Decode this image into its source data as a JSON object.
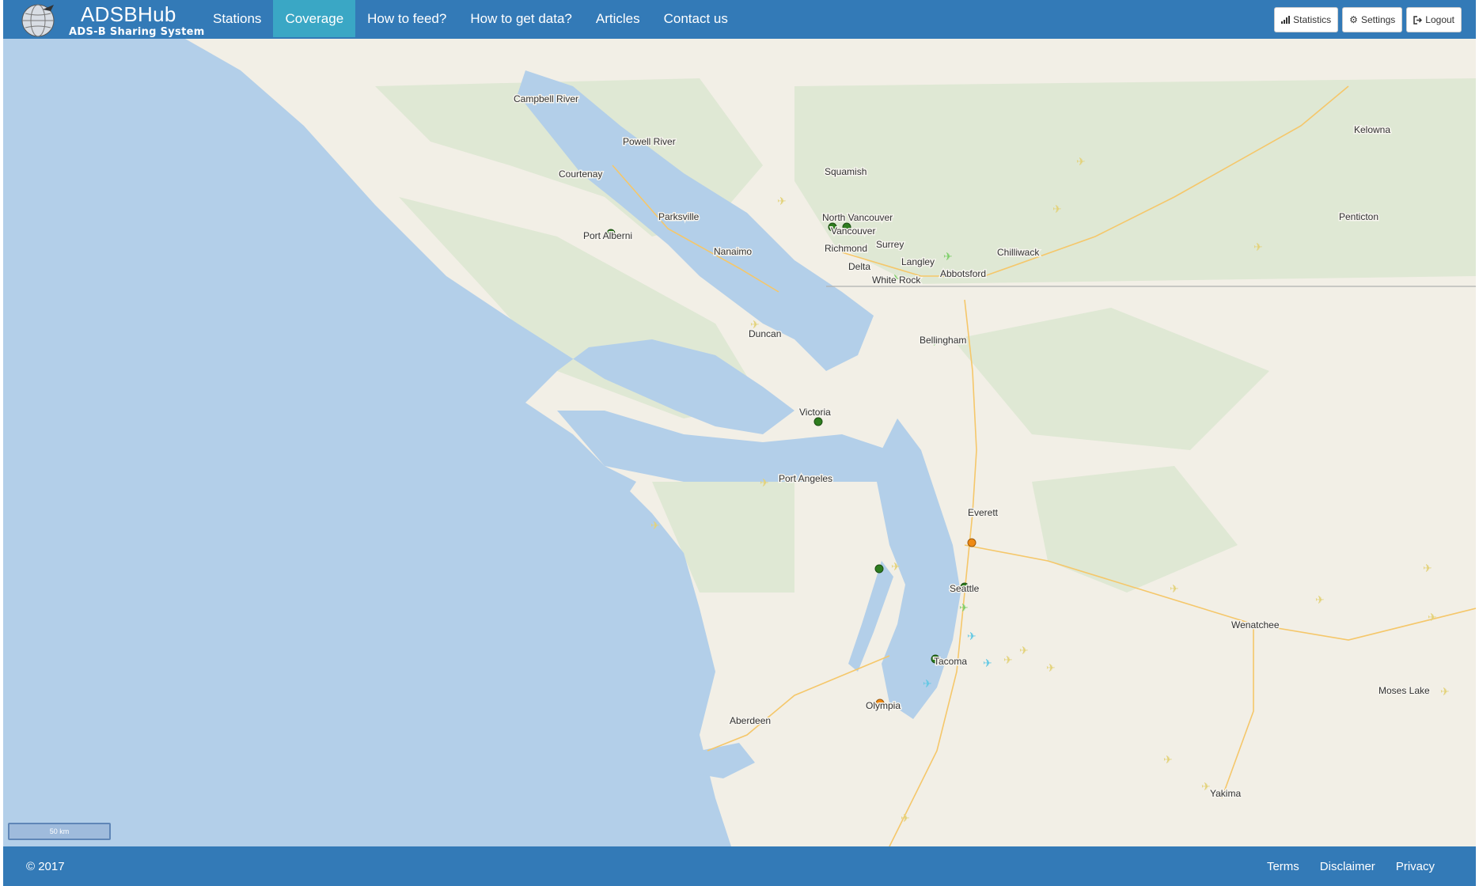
{
  "brand": {
    "title": "ADSBHub",
    "subtitle": "ADS-B Sharing System",
    "logo_icon": "globe-plane-icon"
  },
  "nav": {
    "items": [
      {
        "label": "Stations",
        "active": false
      },
      {
        "label": "Coverage",
        "active": true
      },
      {
        "label": "How to feed?",
        "active": false
      },
      {
        "label": "How to get data?",
        "active": false
      },
      {
        "label": "Articles",
        "active": false
      },
      {
        "label": "Contact us",
        "active": false
      }
    ]
  },
  "toolbar": {
    "statistics_label": "Statistics",
    "statistics_icon": "bar-chart-icon",
    "settings_label": "Settings",
    "settings_icon": "gear-icon",
    "logout_label": "Logout",
    "logout_icon": "logout-icon"
  },
  "map": {
    "cities": [
      "Campbell River",
      "Powell River",
      "Courtenay",
      "Squamish",
      "Kelowna",
      "Penticton",
      "North Vancouver",
      "Vancouver",
      "Surrey",
      "Richmond",
      "Langley",
      "Delta",
      "White Rock",
      "Abbotsford",
      "Chilliwack",
      "Port Alberni",
      "Parksville",
      "Nanaimo",
      "Duncan",
      "Bellingham",
      "Victoria",
      "Port Angeles",
      "Everett",
      "Seattle",
      "Wenatchee",
      "Tacoma",
      "Moses Lake",
      "Olympia",
      "Aberdeen",
      "Yakima"
    ],
    "scale_label": "50 km",
    "colors": {
      "water": "#b3cfe9",
      "land": "#f2efe6",
      "station_green": "#2e7d1f",
      "station_orange": "#ef8a14",
      "plane_yellow": "#e3d27a",
      "plane_green": "#7ecf6a",
      "plane_cyan": "#62c8e4"
    }
  },
  "footer": {
    "copyright": "© 2017",
    "links": [
      "Terms",
      "Disclaimer",
      "Privacy"
    ]
  }
}
